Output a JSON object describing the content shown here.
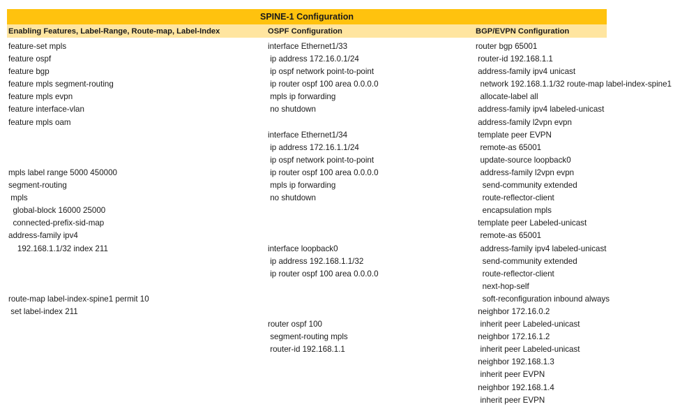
{
  "table": {
    "title": "SPINE-1 Configuration",
    "columns": [
      {
        "header": "Enabling Features, Label-Range, Route-map, Label-Index",
        "lines": [
          "feature-set mpls",
          "feature ospf",
          "feature bgp",
          "feature mpls segment-routing",
          "feature mpls evpn",
          "feature interface-vlan",
          "feature mpls oam",
          "",
          "",
          "",
          "mpls label range 5000 450000",
          "segment-routing",
          " mpls",
          "  global-block 16000 25000",
          "  connected-prefix-sid-map",
          "address-family ipv4",
          "    192.168.1.1/32 index 211",
          "",
          "",
          "",
          "route-map label-index-spine1 permit 10",
          " set label-index 211"
        ]
      },
      {
        "header": "OSPF Configuration",
        "lines": [
          "interface Ethernet1/33",
          " ip address 172.16.0.1/24",
          " ip ospf network point-to-point",
          " ip router ospf 100 area 0.0.0.0",
          " mpls ip forwarding",
          " no shutdown",
          "",
          "interface Ethernet1/34",
          " ip address 172.16.1.1/24",
          " ip ospf network point-to-point",
          " ip router ospf 100 area 0.0.0.0",
          " mpls ip forwarding",
          " no shutdown",
          "",
          "",
          "",
          "interface loopback0",
          " ip address 192.168.1.1/32",
          " ip router ospf 100 area 0.0.0.0",
          "",
          "",
          "",
          "router ospf 100",
          " segment-routing mpls",
          " router-id 192.168.1.1"
        ]
      },
      {
        "header": "BGP/EVPN Configuration",
        "lines": [
          "router bgp 65001",
          " router-id 192.168.1.1",
          " address-family ipv4 unicast",
          "  network 192.168.1.1/32 route-map label-index-spine1",
          "  allocate-label all",
          " address-family ipv4 labeled-unicast",
          " address-family l2vpn evpn",
          " template peer EVPN",
          "  remote-as 65001",
          "  update-source loopback0",
          "  address-family l2vpn evpn",
          "   send-community extended",
          "   route-reflector-client",
          "   encapsulation mpls",
          " template peer Labeled-unicast",
          "  remote-as 65001",
          "  address-family ipv4 labeled-unicast",
          "   send-community extended",
          "   route-reflector-client",
          "   next-hop-self",
          "   soft-reconfiguration inbound always",
          " neighbor 172.16.0.2",
          "  inherit peer Labeled-unicast",
          " neighbor 172.16.1.2",
          "  inherit peer Labeled-unicast",
          " neighbor 192.168.1.3",
          "  inherit peer EVPN",
          " neighbor 192.168.1.4",
          "  inherit peer EVPN"
        ]
      }
    ]
  },
  "colors": {
    "title_bar": "#FFC20E",
    "header_row": "#FFE5A0",
    "text": "#1a1a1a"
  }
}
